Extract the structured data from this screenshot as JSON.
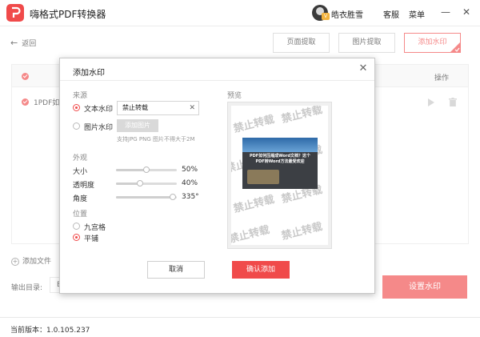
{
  "app": {
    "title": "嗨格式PDF转换器",
    "user_name": "皓衣胜雪",
    "vip_badge": "V",
    "service": "客服",
    "menu": "菜单"
  },
  "toolbar": {
    "back": "返回",
    "page_extract": "页面提取",
    "image_extract": "图片提取",
    "add_watermark": "添加水印"
  },
  "list": {
    "header_action": "操作",
    "row_name": "1PDF如何",
    "add_file": "添加文件"
  },
  "output": {
    "label": "输出目录:",
    "value": "E",
    "set_button": "设置水印"
  },
  "status": {
    "version_label": "当前版本：1.0.105.237"
  },
  "dialog": {
    "title": "添加水印",
    "source_label": "来源",
    "text_watermark": "文本水印",
    "text_value": "禁止转载",
    "image_watermark": "图片水印",
    "add_image": "添加图片",
    "hint": "支持JPG PNG 图片不得大于2M",
    "appearance_label": "外观",
    "size_label": "大小",
    "size_value": "50%",
    "size_fraction": 0.5,
    "opacity_label": "透明度",
    "opacity_value": "40%",
    "opacity_fraction": 0.4,
    "angle_label": "角度",
    "angle_value": "335°",
    "angle_fraction": 0.93,
    "position_label": "位置",
    "grid9": "九宫格",
    "tile": "平铺",
    "preview_label": "预览",
    "watermark_text": "禁止转载",
    "preview_headline": "PDF如何压缩成Word文档？这个PDF转Word方法最受欢迎",
    "cancel": "取消",
    "confirm": "确认添加"
  },
  "colors": {
    "accent": "#f04a4a"
  }
}
